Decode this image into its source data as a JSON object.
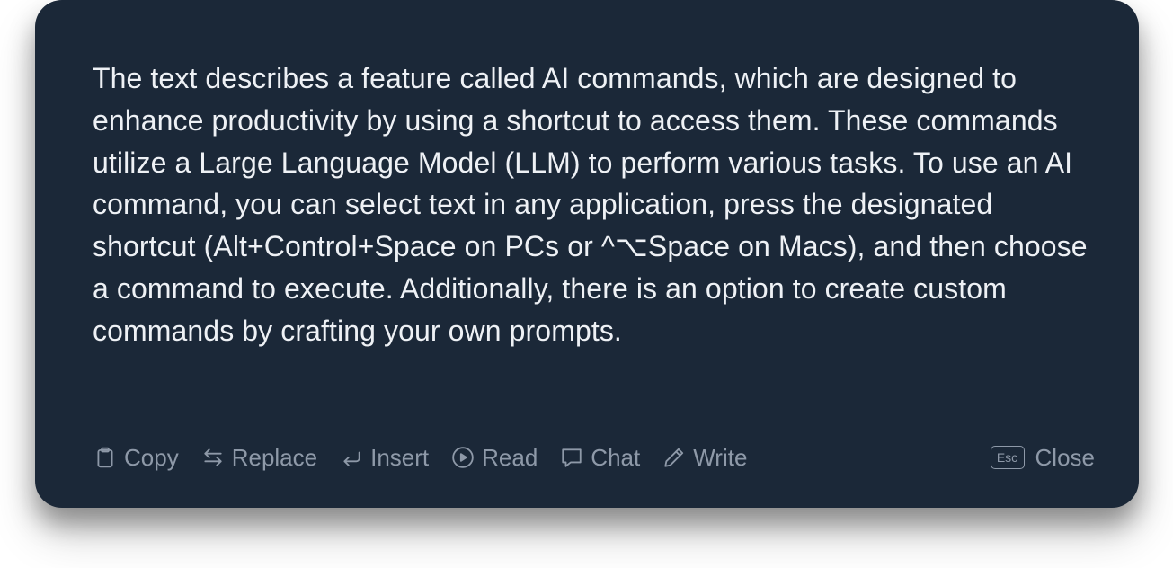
{
  "summary": {
    "text": "The text describes a feature called AI commands, which are designed to enhance productivity by using a shortcut to access them. These commands utilize a Large Language Model (LLM) to perform various tasks. To use an AI command, you can select text in any application, press the designated shortcut (Alt+Control+Space on PCs or ^⌥Space on Macs), and then choose a command to execute. Additionally, there is an option to create custom commands by crafting your own prompts."
  },
  "actions": {
    "copy": {
      "label": "Copy",
      "icon": "clipboard-icon"
    },
    "replace": {
      "label": "Replace",
      "icon": "swap-arrows-icon"
    },
    "insert": {
      "label": "Insert",
      "icon": "return-arrow-icon"
    },
    "read": {
      "label": "Read",
      "icon": "play-circle-icon"
    },
    "chat": {
      "label": "Chat",
      "icon": "chat-bubble-icon"
    },
    "write": {
      "label": "Write",
      "icon": "pencil-icon"
    }
  },
  "close": {
    "key": "Esc",
    "label": "Close"
  },
  "colors": {
    "panel_background": "#1b2838",
    "body_text": "#eef1f5",
    "muted_text": "#8e99a8"
  }
}
